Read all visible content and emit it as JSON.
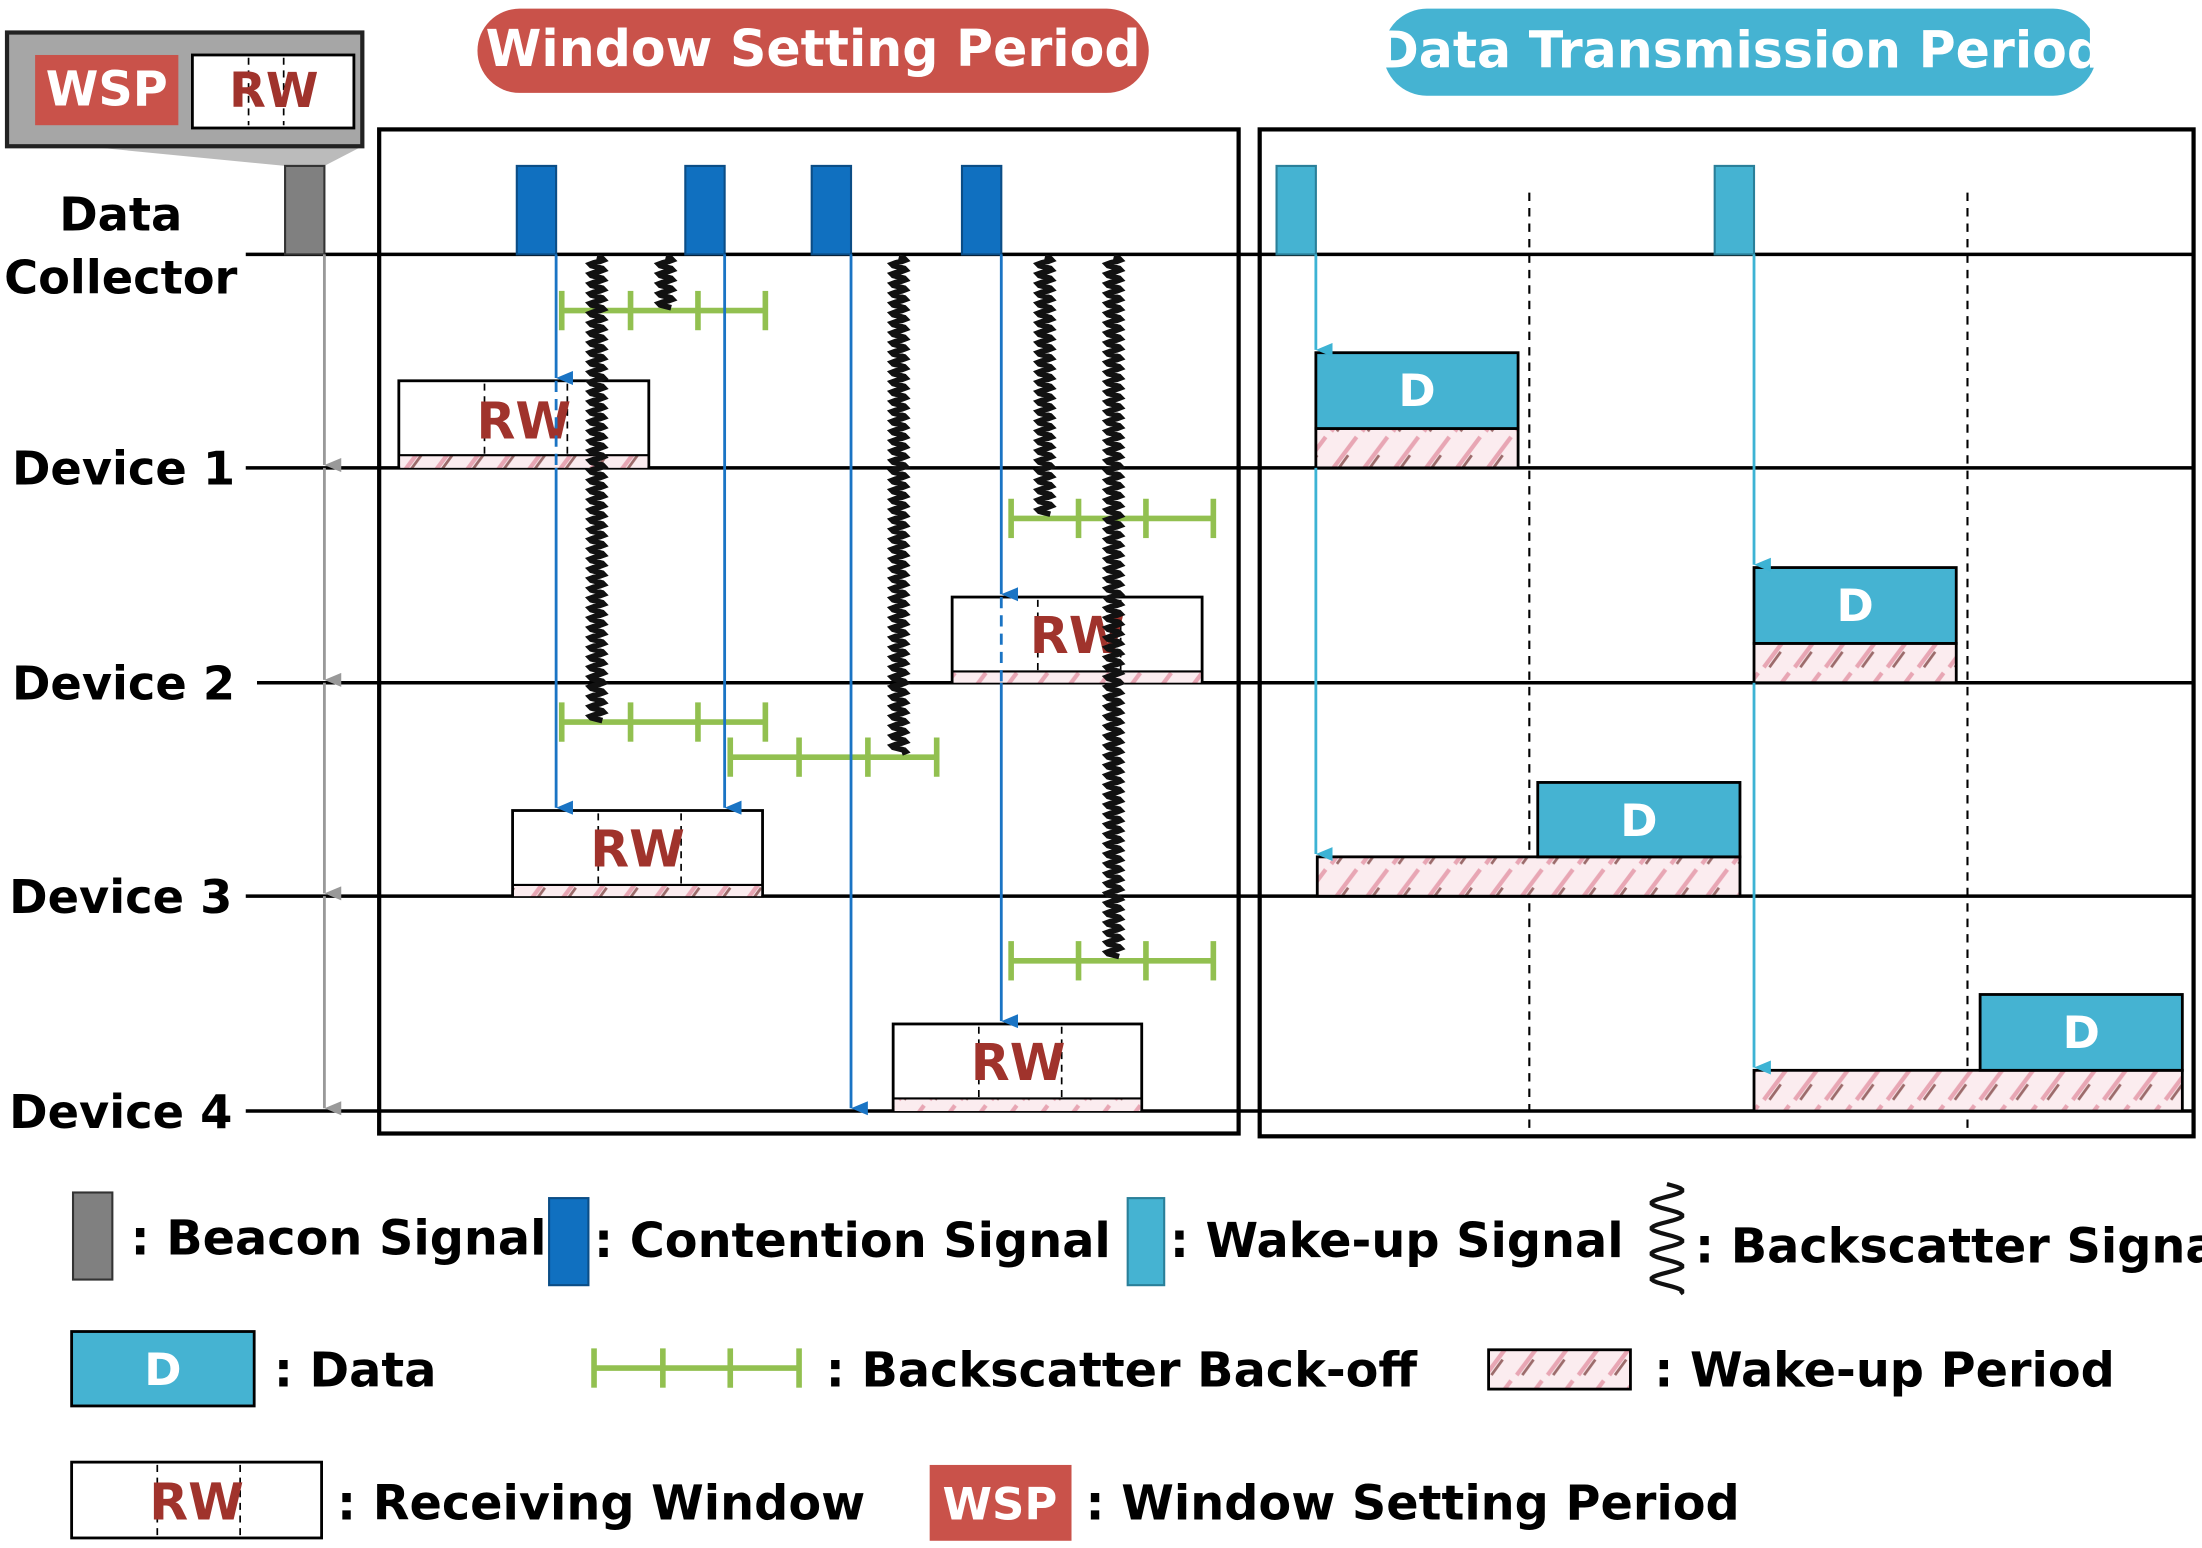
{
  "headers": {
    "wsp": "Window Setting Period",
    "dtp": "Data Transmission Period"
  },
  "inset": {
    "wsp": "WSP",
    "rw": "RW"
  },
  "rows": {
    "collector_line1": "Data",
    "collector_line2": "Collector",
    "device1": "Device 1",
    "device2": "Device 2",
    "device3": "Device 3",
    "device4": "Device 4"
  },
  "box_labels": {
    "rw": "RW",
    "d": "D"
  },
  "legend": {
    "beacon": ": Beacon Signal",
    "contention": ": Contention Signal",
    "wakeup": ": Wake-up Signal",
    "backscatter": ": Backscatter Signal",
    "data_symbol": "D",
    "data": ": Data",
    "backoff": ": Backscatter Back-off",
    "wakeup_period": ": Wake-up Period",
    "rw_symbol": "RW",
    "rw": ": Receiving Window",
    "wsp_symbol": "WSP",
    "wsp": ": Window Setting Period"
  },
  "colors": {
    "wsp": "#c9524a",
    "dtp": "#45b3d2",
    "contention": "#1070c0",
    "wakeup": "#45b3d2",
    "beacon": "#808080",
    "backoff": "#92c050",
    "rw_text": "#a0332c"
  }
}
